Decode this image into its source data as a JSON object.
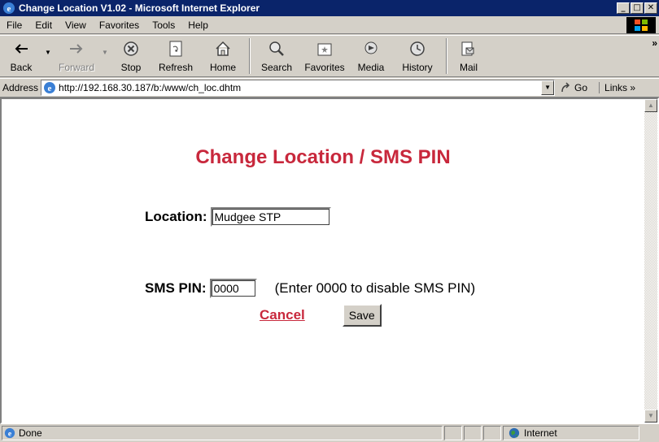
{
  "window": {
    "title": "Change Location V1.02 - Microsoft Internet Explorer",
    "minimize": "_",
    "maximize": "□",
    "close": "✕"
  },
  "menu": {
    "items": [
      {
        "label": "File"
      },
      {
        "label": "Edit"
      },
      {
        "label": "View"
      },
      {
        "label": "Favorites"
      },
      {
        "label": "Tools"
      },
      {
        "label": "Help"
      }
    ]
  },
  "toolbar": {
    "back": "Back",
    "forward": "Forward",
    "stop": "Stop",
    "refresh": "Refresh",
    "home": "Home",
    "search": "Search",
    "favorites": "Favorites",
    "media": "Media",
    "history": "History",
    "mail": "Mail",
    "more": "»"
  },
  "address": {
    "label": "Address",
    "url": "http://192.168.30.187/b:/www/ch_loc.dhtm",
    "go": "Go",
    "links": "Links »"
  },
  "page": {
    "title": "Change Location / SMS PIN",
    "location_label": "Location:",
    "location_value": "Mudgee STP",
    "sms_label": "SMS PIN:",
    "sms_value": "0000",
    "sms_hint": "(Enter 0000 to disable SMS PIN)",
    "cancel": "Cancel",
    "save": "Save"
  },
  "status": {
    "text": "Done",
    "zone": "Internet"
  },
  "colors": {
    "titlebar": "#0a246a",
    "accent_red": "#c8283c",
    "chrome": "#d4d0c8"
  }
}
